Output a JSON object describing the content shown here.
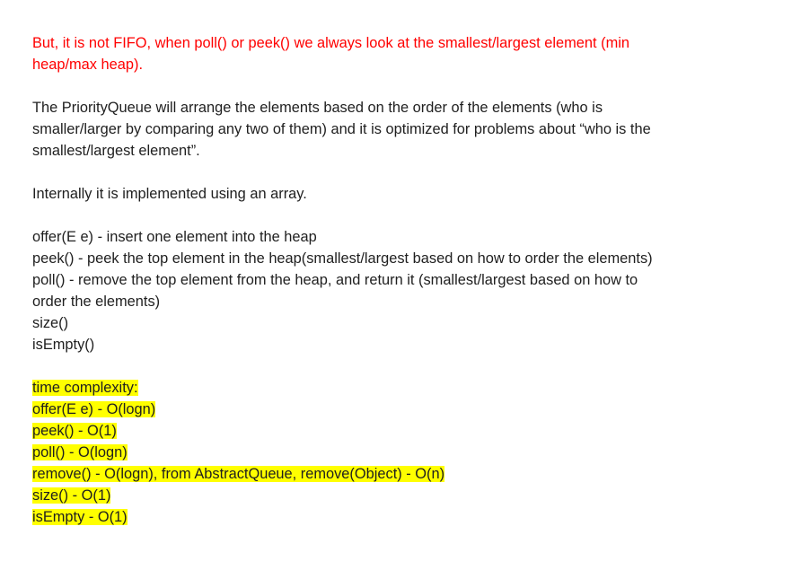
{
  "intro": {
    "line1": "But, it is not FIFO, when poll() or peek() we always look at the smallest/largest element (min",
    "line2": "heap/max heap).",
    "color": "#ff0000"
  },
  "description": {
    "line1": "The PriorityQueue will arrange the elements based on the order of the elements (who is",
    "line2": "smaller/larger by comparing any two of them) and it is optimized for problems about “who is the",
    "line3": "smallest/largest element”."
  },
  "implementation": "Internally it is implemented using an array.",
  "methods": [
    "offer(E e) - insert one element into the heap",
    "peek() - peek the top element in the heap(smallest/largest based on how to order the elements)",
    "poll() - remove the top element from the heap, and return it (smallest/largest based on how to",
    "order the elements)",
    "size()",
    "isEmpty()"
  ],
  "complexity": {
    "highlight_color": "#ffff00",
    "lines": [
      "time complexity:",
      "offer(E e) - O(logn)",
      "peek() - O(1)",
      "poll() - O(logn)",
      "remove() - O(logn), from AbstractQueue, remove(Object) - O(n)",
      "size() - O(1)",
      "isEmpty - O(1)"
    ]
  }
}
